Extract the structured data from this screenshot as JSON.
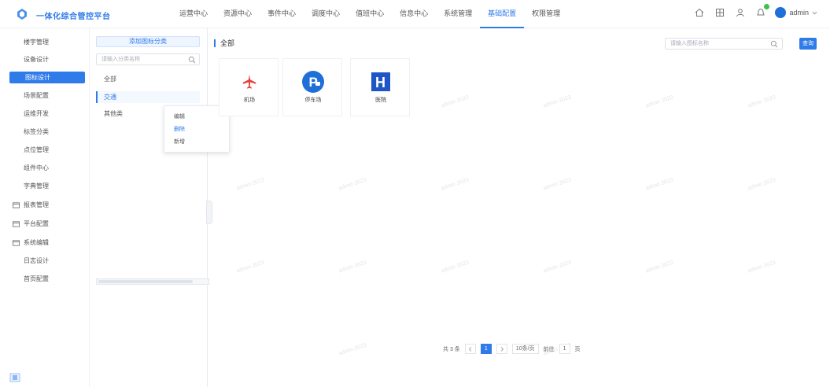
{
  "header": {
    "app_title": "一体化综合管控平台",
    "nav": [
      {
        "label": "运营中心",
        "active": false
      },
      {
        "label": "资源中心",
        "active": false
      },
      {
        "label": "事件中心",
        "active": false
      },
      {
        "label": "调度中心",
        "active": false
      },
      {
        "label": "值班中心",
        "active": false
      },
      {
        "label": "信息中心",
        "active": false
      },
      {
        "label": "系统管理",
        "active": false
      },
      {
        "label": "基础配置",
        "active": true
      },
      {
        "label": "权限管理",
        "active": false
      }
    ],
    "user_name": "admin"
  },
  "sidebar": {
    "items": [
      {
        "label": "楼宇管理",
        "active": false
      },
      {
        "label": "设备设计",
        "active": false
      },
      {
        "label": "图标设计",
        "active": true
      },
      {
        "label": "场景配置",
        "active": false
      },
      {
        "label": "运维开发",
        "active": false
      },
      {
        "label": "标签分类",
        "active": false
      },
      {
        "label": "点位管理",
        "active": false
      },
      {
        "label": "组件中心",
        "active": false
      },
      {
        "label": "字典管理",
        "active": false
      },
      {
        "label": "报表管理",
        "active": false
      },
      {
        "label": "平台配置",
        "active": false
      },
      {
        "label": "系统编辑",
        "active": false
      },
      {
        "label": "日志设计",
        "active": false
      },
      {
        "label": "首页配置",
        "active": false
      }
    ]
  },
  "category_panel": {
    "add_button": "添加图标分类",
    "search_placeholder": "请输入分类名称",
    "tree": [
      {
        "label": "全部",
        "selected": false
      },
      {
        "label": "交通",
        "selected": true
      },
      {
        "label": "其他类",
        "selected": false
      }
    ],
    "context_menu": [
      "编辑",
      "删除",
      "新增"
    ]
  },
  "main": {
    "section_title": "全部",
    "search_placeholder": "请输入图标名称",
    "query_button": "查询",
    "cards": [
      {
        "label": "机场",
        "icon": "airplane-icon",
        "color": "#e8403a"
      },
      {
        "label": "停车场",
        "icon": "parking-icon",
        "color": "#1e6fd8"
      },
      {
        "label": "医院",
        "icon": "hospital-icon",
        "color": "#1e56c7"
      }
    ],
    "watermark": "admin 2023"
  },
  "pagination": {
    "total_text": "共 3 条",
    "current_page": "1",
    "page_size": "10条/页",
    "goto_text": "前往",
    "goto_page": "1",
    "goto_suffix": "页"
  },
  "colors": {
    "accent": "#2f7be9",
    "notification_badge": "#3ac24b"
  }
}
